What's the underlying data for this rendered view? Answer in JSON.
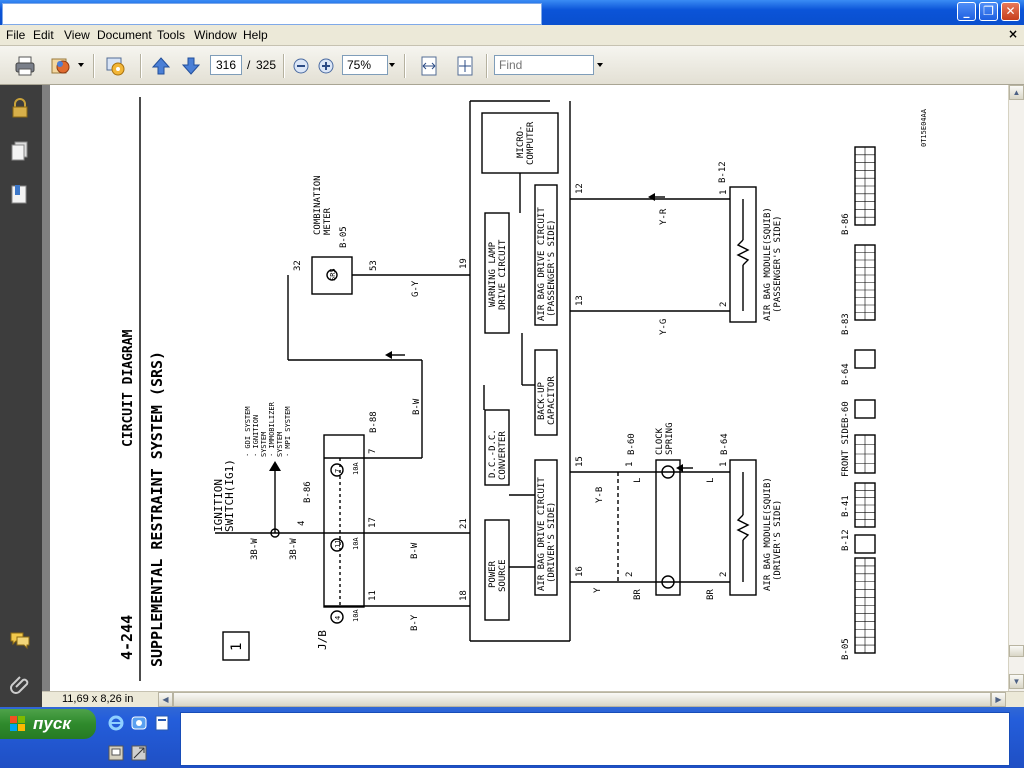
{
  "menu": {
    "file": "File",
    "edit": "Edit",
    "view": "View",
    "document": "Document",
    "tools": "Tools",
    "window": "Window",
    "help": "Help",
    "close_glyph": "×"
  },
  "toolbar": {
    "page_current": "316",
    "page_separator": "/",
    "page_total": "325",
    "zoom": "75%",
    "find_placeholder": "Find"
  },
  "window_buttons": {
    "minimize": "_",
    "maximize": "❐",
    "close": "✕"
  },
  "status": {
    "page_size": "11,69 x 8,26 in"
  },
  "taskbar": {
    "start_label": "пуск"
  },
  "diagram": {
    "page_number": "4-244",
    "section_title": "CIRCUIT DIAGRAM",
    "system_title": "SUPPLEMENTAL RESTRAINT SYSTEM (SRS)",
    "figure_number": "1",
    "code": "0T15E04AA",
    "ignition_line1": "IGNITION",
    "ignition_line2": "SWITCH(IG1)",
    "systems": [
      "· GDI SYSTEM",
      "· IGNITION",
      "  SYSTEM",
      "· IMMOBILIZER",
      "  SYSTEM",
      "· MPI SYSTEM"
    ],
    "junction_block": "J/B",
    "connectors": {
      "b86": "B-86",
      "b88": "B-88",
      "b05": "B-05",
      "b12": "B-12",
      "b60": "B-60",
      "b64": "B-64",
      "b83": "B-83",
      "b41": "B-41"
    },
    "fuses": {
      "f4": "4",
      "f11": "11",
      "f7": "7",
      "rating": "10A"
    },
    "wire_colors": {
      "w3bw": "3B-W",
      "w3bw2": "3B-W",
      "bw": "B-W",
      "bw2": "B-W",
      "by": "B-Y",
      "gy": "G-Y",
      "yr": "Y-R",
      "yg": "Y-G",
      "yb": "Y-B",
      "y": "Y",
      "l1": "L",
      "l2": "L",
      "br1": "BR",
      "br2": "BR"
    },
    "pins": {
      "p4": "4",
      "p17": "17",
      "p11": "11",
      "p7": "7",
      "p32": "32",
      "p53": "53",
      "p21": "21",
      "p18": "18",
      "p19": "19",
      "p12": "12",
      "p13": "13",
      "p15": "15",
      "p16": "16",
      "m1": "1",
      "m2": "2",
      "c1": "1",
      "c2": "2",
      "d1": "1",
      "d2": "2"
    },
    "combination_meter_1": "COMBINATION",
    "combination_meter_2": "METER",
    "srs_label": "SRS",
    "blocks": {
      "microcomputer_1": "MICRO-",
      "microcomputer_2": "COMPUTER",
      "warning_1": "WARNING LAMP",
      "warning_2": "DRIVE CIRCUIT",
      "passenger_1": "AIR BAG DRIVE CIRCUIT",
      "passenger_2": "(PASSENGER'S SIDE)",
      "backup_1": "BACK-UP",
      "backup_2": "CAPACITOR",
      "dcdc_1": "D.C.-D.C.",
      "dcdc_2": "CONVERTER",
      "power_1": "POWER",
      "power_2": "SOURCE",
      "driver_1": "AIR BAG DRIVE CIRCUIT",
      "driver_2": "(DRIVER'S SIDE)"
    },
    "module_passenger_1": "AIR BAG MODULE(SQUIB)",
    "module_passenger_2": "(PASSENGER'S SIDE)",
    "module_driver_1": "AIR BAG MODULE(SQUIB)",
    "module_driver_2": "(DRIVER'S SIDE)",
    "clock_spring_1": "CLOCK",
    "clock_spring_2": "SPRING",
    "front_side": "FRONT SIDE"
  }
}
